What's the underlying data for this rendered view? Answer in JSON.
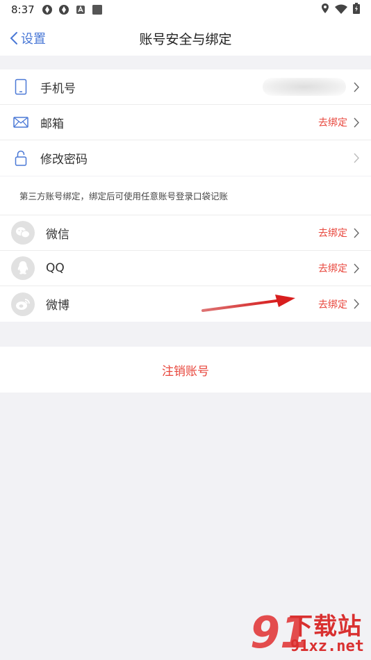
{
  "status_bar": {
    "time": "8:37"
  },
  "nav": {
    "back_label": "设置",
    "title": "账号安全与绑定"
  },
  "account": [
    {
      "label": "手机号",
      "action": "",
      "icon": "phone-icon"
    },
    {
      "label": "邮箱",
      "action": "去绑定",
      "icon": "mail-icon"
    },
    {
      "label": "修改密码",
      "action": "",
      "icon": "lock-icon"
    }
  ],
  "hint": "第三方账号绑定，绑定后可使用任意账号登录口袋记账",
  "social": [
    {
      "label": "微信",
      "action": "去绑定",
      "icon": "wechat-icon"
    },
    {
      "label": "QQ",
      "action": "去绑定",
      "icon": "qq-icon"
    },
    {
      "label": "微博",
      "action": "去绑定",
      "icon": "weibo-icon"
    }
  ],
  "cancel_account": "注销账号",
  "watermark": {
    "cn": "下载站",
    "url": "91xz.net"
  },
  "colors": {
    "accent": "#4a78d6",
    "danger": "#e8463c",
    "background": "#f2f2f5"
  }
}
